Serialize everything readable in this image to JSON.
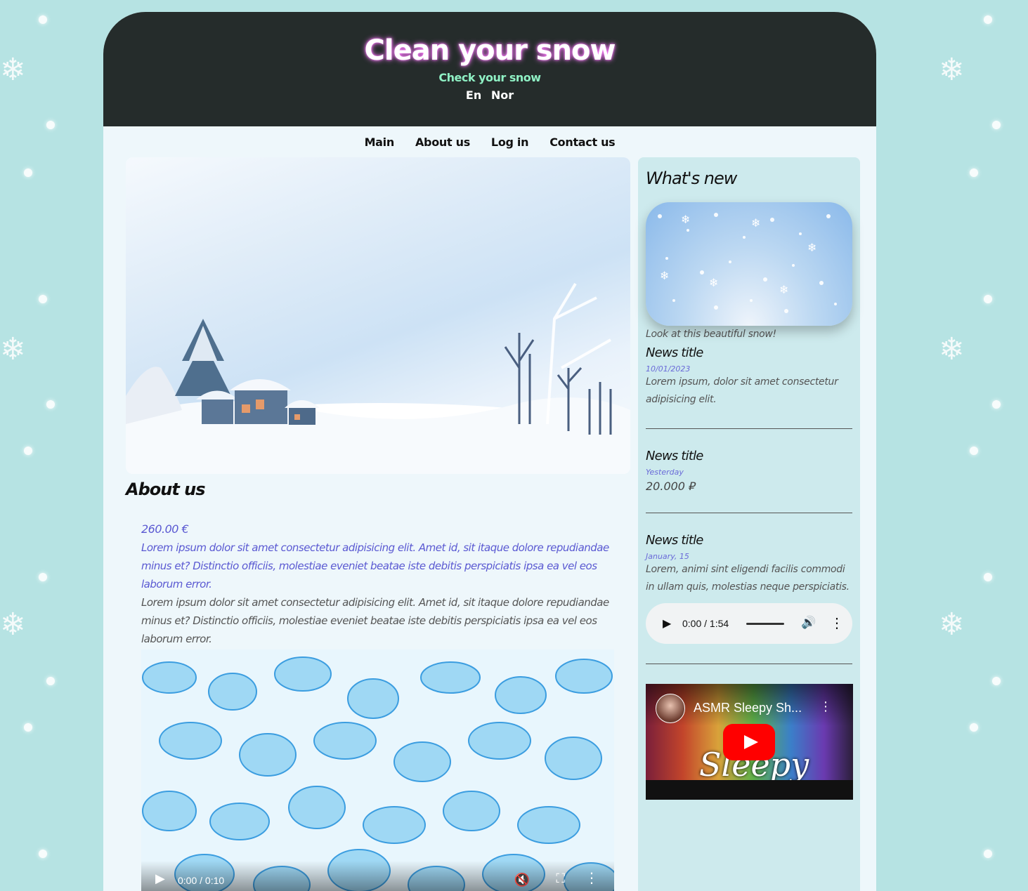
{
  "header": {
    "title": "Clean your snow",
    "subtitle": "Check your snow",
    "languages": [
      "En",
      "Nor"
    ]
  },
  "nav": {
    "items": [
      "Main",
      "About us",
      "Log in",
      "Contact us"
    ]
  },
  "about": {
    "heading": "About us",
    "price": "260.00 €",
    "text_blue": "Lorem ipsum dolor sit amet consectetur adipisicing elit. Amet id, sit itaque dolore repudiandae minus et? Distinctio officiis, molestiae eveniet beatae iste debitis perspiciatis ipsa ea vel eos laborum error.",
    "text_grey": "Lorem ipsum dolor sit amet consectetur adipisicing elit. Amet id, sit itaque dolore repudiandae minus et? Distinctio officiis, molestiae eveniet beatae iste debitis perspiciatis ipsa ea vel eos laborum error.",
    "video": {
      "time": "0:00 / 0:10"
    }
  },
  "sidebar": {
    "heading": "What's new",
    "image_caption": "Look at this beautiful snow!",
    "news": [
      {
        "title": "News title",
        "date": "10/01/2023",
        "text": "Lorem ipsum, dolor sit amet consectetur adipisicing elit."
      },
      {
        "title": "News title",
        "date": "Yesterday",
        "price": "20.000 ₽"
      },
      {
        "title": "News title",
        "date": "January, 15",
        "text": "Lorem, animi sint eligendi facilis commodi in ullam quis, molestias neque perspiciatis."
      }
    ],
    "audio": {
      "time": "0:00 / 1:54"
    },
    "youtube": {
      "title": "ASMR Sleepy Sh...",
      "thumbnail_text": "Sleepy"
    }
  },
  "colors": {
    "background": "#b6e3e3",
    "header": "#252c2b",
    "subtitle": "#8ff0c4",
    "accent_text": "#5a59d2",
    "sidebar": "#cdeaed"
  }
}
